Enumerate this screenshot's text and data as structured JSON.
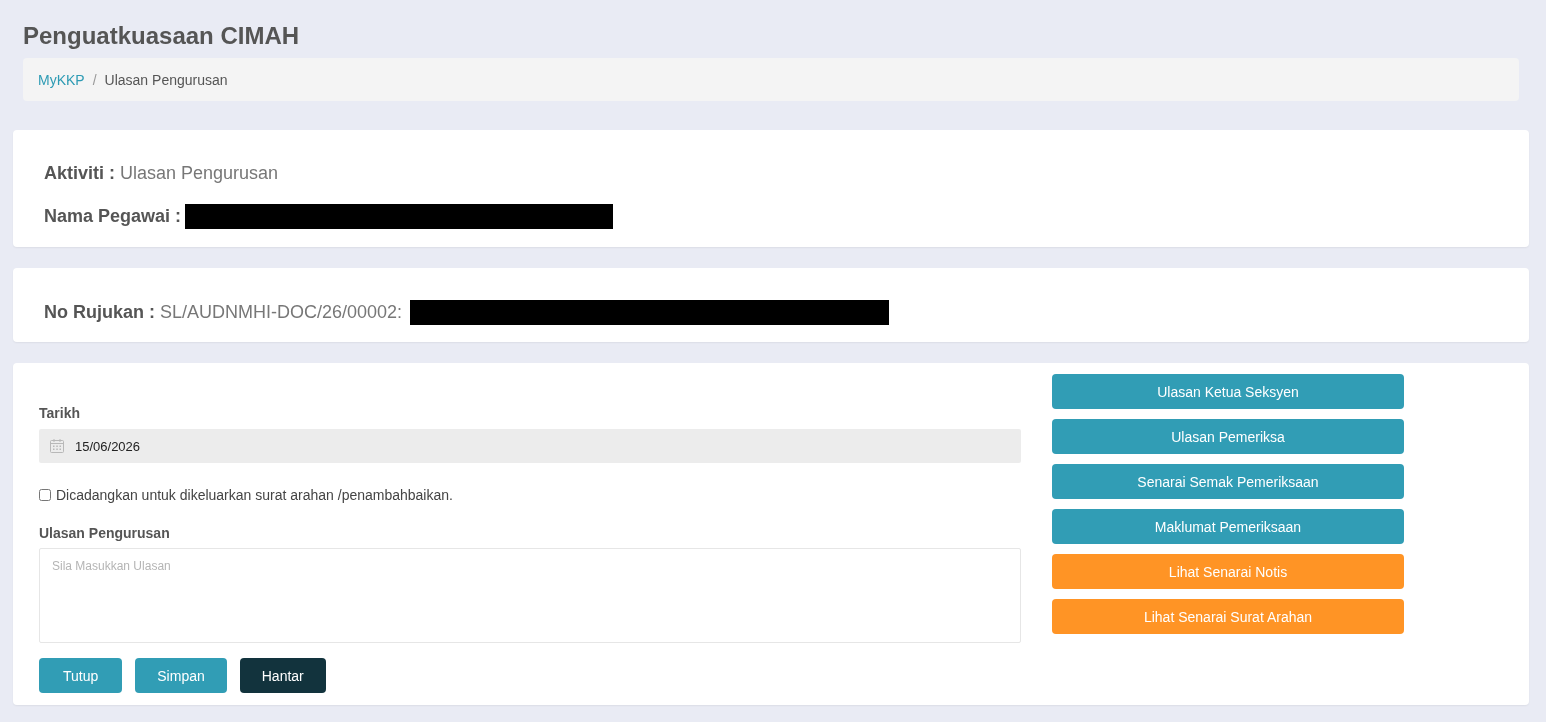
{
  "page": {
    "title": "Penguatkuasaan CIMAH"
  },
  "breadcrumb": {
    "separator": "/",
    "items": [
      {
        "label": "MyKKP",
        "current": false
      },
      {
        "label": "Ulasan Pengurusan",
        "current": true
      }
    ]
  },
  "info": [
    {
      "label": "Aktiviti :",
      "value": "Ulasan Pengurusan"
    },
    {
      "label": "Nama Pegawai :",
      "redacted": true
    }
  ],
  "reference": {
    "label": "No Rujukan :",
    "value": "SL/AUDNMHI-DOC/26/00002:",
    "redacted": true
  },
  "form": {
    "date": {
      "label": "Tarikh",
      "value": "15/06/2026"
    },
    "checkbox": {
      "label": "Dicadangkan untuk dikeluarkan surat arahan /penambahbaikan.",
      "checked": false
    },
    "comment": {
      "label": "Ulasan Pengurusan",
      "placeholder": "Sila Masukkan Ulasan"
    },
    "buttons": [
      {
        "label": "Tutup",
        "kind": "primary"
      },
      {
        "label": "Simpan",
        "kind": "primary"
      },
      {
        "label": "Hantar",
        "kind": "dark"
      }
    ]
  },
  "side_buttons": [
    {
      "label": "Ulasan Ketua Seksyen",
      "kind": "info"
    },
    {
      "label": "Ulasan Pemeriksa",
      "kind": "info"
    },
    {
      "label": "Senarai Semak Pemeriksaan",
      "kind": "info"
    },
    {
      "label": "Maklumat Pemeriksaan",
      "kind": "info"
    },
    {
      "label": "Lihat Senarai Notis",
      "kind": "warning"
    },
    {
      "label": "Lihat Senarai Surat Arahan",
      "kind": "warning"
    }
  ]
}
